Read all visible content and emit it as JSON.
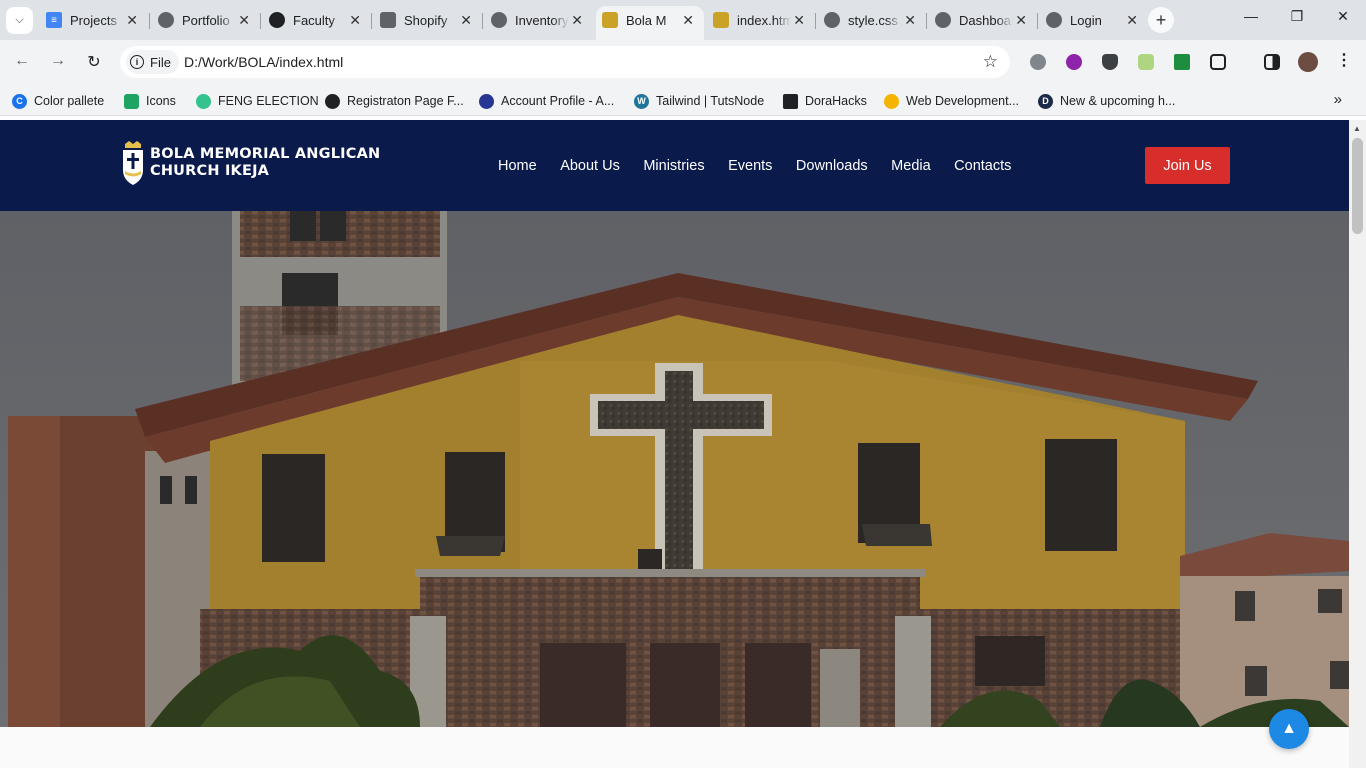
{
  "browser": {
    "tabs": [
      {
        "title": "Projects",
        "favicon": "docs-icon",
        "color": "#4285f4"
      },
      {
        "title": "Portfolio",
        "favicon": "globe-icon",
        "color": "#5f6368"
      },
      {
        "title": "Faculty",
        "favicon": "faculty-icon",
        "color": "#202124"
      },
      {
        "title": "Shopify",
        "favicon": "shopify-icon",
        "color": "#5f6368"
      },
      {
        "title": "Inventory",
        "favicon": "globe-icon",
        "color": "#5f6368"
      },
      {
        "title": "Bola M",
        "favicon": "church-icon",
        "color": "#c9a227",
        "active": true
      },
      {
        "title": "index.html",
        "favicon": "church-icon",
        "color": "#c9a227"
      },
      {
        "title": "style.css",
        "favicon": "globe-icon",
        "color": "#5f6368"
      },
      {
        "title": "Dashboard",
        "favicon": "globe-icon",
        "color": "#5f6368"
      },
      {
        "title": "Login",
        "favicon": "globe-icon",
        "color": "#5f6368"
      }
    ],
    "address": {
      "scheme_label": "File",
      "url": "D:/Work/BOLA/index.html"
    },
    "bookmarks": [
      {
        "label": "Color pallete",
        "icon": "color-pallete-icon",
        "color": "#1a73e8"
      },
      {
        "label": "Icons",
        "icon": "icons-icon",
        "color": "#1ea362"
      },
      {
        "label": "FENG ELECTION",
        "icon": "feng-icon",
        "color": "#34c38f"
      },
      {
        "label": "Registraton Page F...",
        "icon": "chrome-icon",
        "color": "#202124"
      },
      {
        "label": "Account Profile - A...",
        "icon": "account-icon",
        "color": "#283593"
      },
      {
        "label": "Tailwind | TutsNode",
        "icon": "wordpress-icon",
        "color": "#21759b"
      },
      {
        "label": "DoraHacks",
        "icon": "dorahacks-icon",
        "color": "#202124"
      },
      {
        "label": "Web Development...",
        "icon": "webdev-icon",
        "color": "#f4b400"
      },
      {
        "label": "New & upcoming h...",
        "icon": "d-icon",
        "color": "#1c2a4a"
      }
    ]
  },
  "site": {
    "brand_line1": "BOLA MEMORIAL ANGLICAN",
    "brand_line2": "CHURCH IKEJA",
    "nav": [
      "Home",
      "About Us",
      "Ministries",
      "Events",
      "Downloads",
      "Media",
      "Contacts"
    ],
    "cta": "Join Us",
    "colors": {
      "header_bg": "#0a1a4b",
      "cta_bg": "#d72d2b",
      "back_to_top": "#1e88e5"
    }
  }
}
